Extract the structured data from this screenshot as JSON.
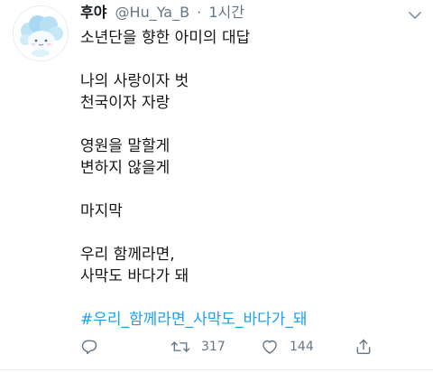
{
  "tweet": {
    "author": {
      "display_name": "후야",
      "handle": "@Hu_Ya_B",
      "avatar_icon": "cloud-character-avatar"
    },
    "separator": "·",
    "time": "1시간",
    "lines": [
      "소년단을 향한 아미의 대답",
      "",
      "나의 사랑이자 벗",
      "천국이자 자랑",
      "",
      "영원을 말할게",
      "변하지 않을게",
      "",
      "마지막",
      "",
      "우리 함께라면,",
      "사막도 바다가 돼",
      ""
    ],
    "hashtag": "#우리_함께라면_사막도_바다가_돼",
    "actions": {
      "reply_icon": "reply-icon",
      "retweet_icon": "retweet-icon",
      "retweet_count": "317",
      "like_icon": "heart-icon",
      "like_count": "144",
      "share_icon": "share-icon"
    },
    "colors": {
      "text": "#14171a",
      "muted": "#657786",
      "link": "#1da1f2"
    }
  }
}
